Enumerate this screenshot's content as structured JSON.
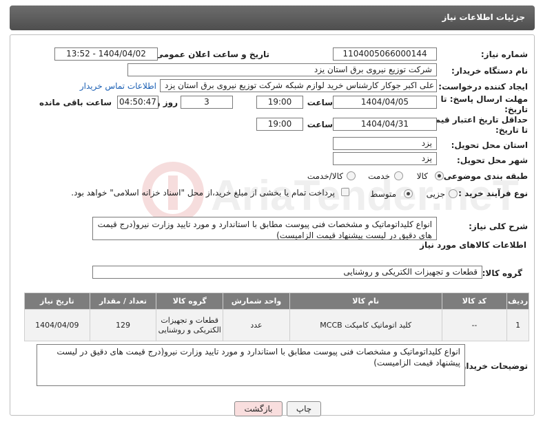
{
  "header": {
    "title": "جزئیات اطلاعات نیاز"
  },
  "form": {
    "need_number_label": "شماره نیاز:",
    "need_number": "1104005066000144",
    "announce_label": "تاریخ و ساعت اعلان عمومی:",
    "announce_value": "1404/04/02 - 13:52",
    "buyer_org_label": "نام دستگاه خریدار:",
    "buyer_org": "شرکت توزیع نیروی برق استان یزد",
    "creator_label": "ایجاد کننده درخواست:",
    "creator": "علی اکبر  جوکار  کارشناس خرید لوازم شبکه  شرکت توزیع نیروی برق استان یزد",
    "contact_link": "اطلاعات تماس خریدار",
    "deadline_label_1": "مهلت ارسال پاسخ: تا",
    "deadline_label_2": "تاریخ:",
    "deadline_date": "1404/04/05",
    "time_label": "ساعت",
    "deadline_time": "19:00",
    "days_value": "3",
    "days_label": "روز و",
    "remaining_value": "04:50:47",
    "remaining_label": "ساعت باقی مانده",
    "validity_label_1": "حداقل تاریخ اعتبار قیمت:",
    "validity_label_2": "تا تاریخ:",
    "validity_date": "1404/04/31",
    "validity_time": "19:00",
    "province_label": "استان محل تحویل:",
    "province": "یزد",
    "city_label": "شهر محل تحویل:",
    "city": "یزد",
    "category_label": "طبقه بندی موضوعی:",
    "category_options": [
      "کالا",
      "خدمت",
      "کالا/خدمت"
    ],
    "process_label": "نوع فرآیند خرید :",
    "process_options": [
      "جزیی",
      "متوسط"
    ],
    "payment_note": "پرداخت تمام یا بخشی از مبلغ خرید،از محل \"اسناد خزانه اسلامی\" خواهد بود.",
    "description_label": "شرح کلی نیاز:",
    "description": "انواع کلیداتوماتیک و مشخصات فنی پیوست مطابق با استاندارد و مورد تایید وزارت نیرو(درج قیمت های دقیق در لیست پیشنهاد قیمت الزامیست)",
    "goods_info_title": "اطلاعات کالاهای مورد نیاز",
    "goods_group_label": "گروه کالا:",
    "goods_group": "قطعات و تجهیزات الکتریکی و روشنایی"
  },
  "table": {
    "headers": [
      "ردیف",
      "کد کالا",
      "نام کالا",
      "واحد شمارش",
      "گروه کالا",
      "تعداد / مقدار",
      "تاریخ نیاز"
    ],
    "rows": [
      {
        "row": "1",
        "code": "--",
        "name": "کلید اتوماتیک کامپکت MCCB",
        "unit": "عدد",
        "group": "قطعات و تجهیزات الکتریکی و روشنایی",
        "qty": "129",
        "date": "1404/04/09"
      }
    ]
  },
  "buyer_notes_label": "توضیحات خریدار:",
  "buyer_notes": "انواع کلیداتوماتیک و مشخصات فنی پیوست مطابق با استاندارد و مورد تایید وزارت نیرو(درج قیمت های دقیق در لیست پیشنهاد قیمت الزامیست)",
  "buttons": {
    "print": "چاپ",
    "back": "بازگشت"
  },
  "watermark_text": "AriaTender.neT",
  "colors": {
    "header_bg": "#555555",
    "link": "#1a5fb4",
    "back_button_bg": "#f9dede",
    "table_header_bg": "#7d7d7d"
  }
}
